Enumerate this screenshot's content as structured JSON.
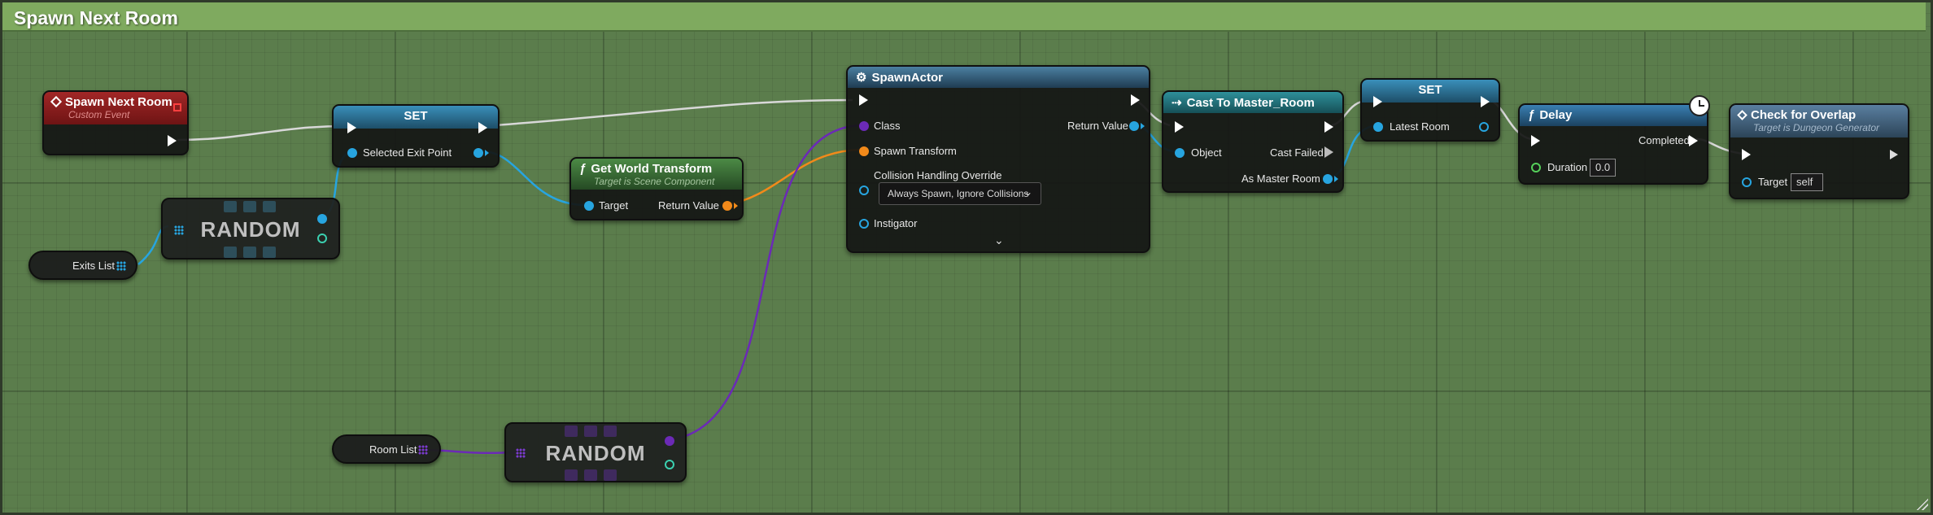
{
  "comment": {
    "title": "Spawn Next Room"
  },
  "nodes": {
    "event": {
      "title": "Spawn Next Room",
      "subtitle": "Custom Event"
    },
    "set1": {
      "title": "SET",
      "pin_label": "Selected Exit Point"
    },
    "random1": {
      "title": "RANDOM"
    },
    "exits_list": {
      "label": "Exits List"
    },
    "get_world_transform": {
      "title": "Get World Transform",
      "subtitle": "Target is Scene Component",
      "target_label": "Target",
      "return_label": "Return Value"
    },
    "spawn_actor": {
      "title": "SpawnActor",
      "class_label": "Class",
      "return_label": "Return Value",
      "spawn_transform_label": "Spawn Transform",
      "collision_label": "Collision Handling Override",
      "collision_value": "Always Spawn, Ignore Collisions",
      "instigator_label": "Instigator"
    },
    "cast": {
      "title": "Cast To Master_Room",
      "object_label": "Object",
      "cast_failed_label": "Cast Failed",
      "as_label": "As Master Room"
    },
    "set2": {
      "title": "SET",
      "pin_label": "Latest Room"
    },
    "delay": {
      "title": "Delay",
      "completed_label": "Completed",
      "duration_label": "Duration",
      "duration_value": "0.0"
    },
    "check_overlap": {
      "title": "Check for Overlap",
      "subtitle": "Target is Dungeon Generator",
      "target_label": "Target",
      "target_value": "self"
    },
    "room_list": {
      "label": "Room List"
    },
    "random2": {
      "title": "RANDOM"
    }
  },
  "icons": {
    "function": "function-icon",
    "event": "event-diamond-icon",
    "cast": "cast-arrow-icon",
    "clock": "clock-icon",
    "chevron": "chevron-down-icon",
    "array": "array-grid-icon"
  },
  "colors": {
    "exec": "#ffffff",
    "object_pin": "#27a5e0",
    "transform_pin": "#f28a1a",
    "class_pin": "#6b2ab6",
    "event_header": "#8e1f1f",
    "function_header": "#3f6a3c",
    "pure_header": "#2d7fa8",
    "comment_header": "#7faa5f"
  }
}
